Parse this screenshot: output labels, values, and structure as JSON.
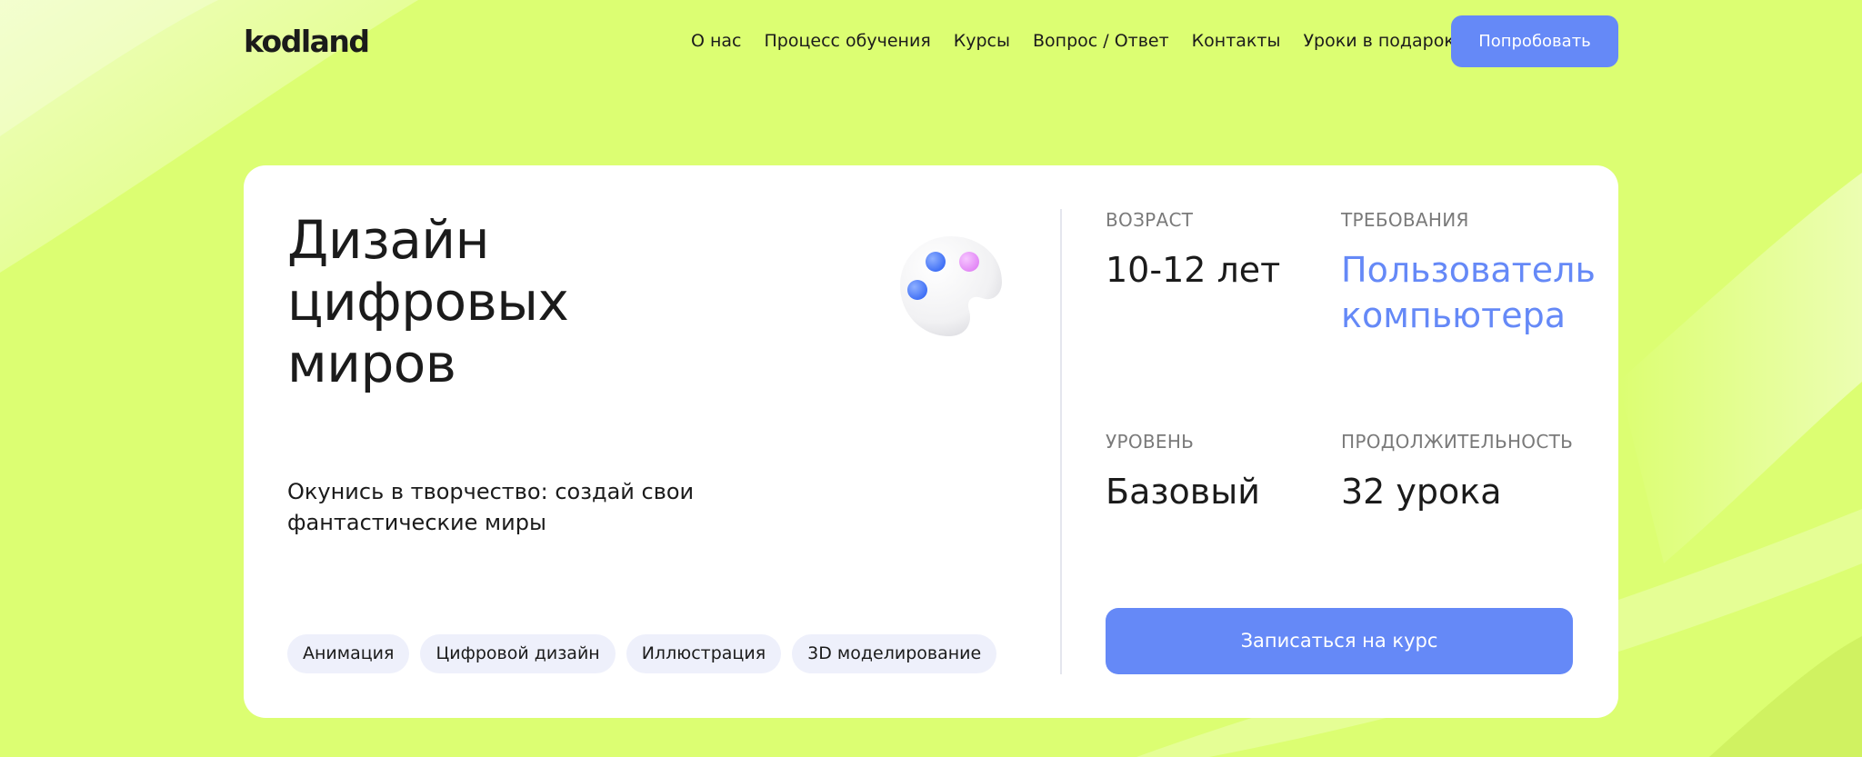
{
  "brand": {
    "logo_text": "kodland",
    "background_color": "#dcfe72",
    "accent_color": "#6589f7"
  },
  "header": {
    "nav": [
      {
        "label": "О нас"
      },
      {
        "label": "Процесс обучения"
      },
      {
        "label": "Курсы"
      },
      {
        "label": "Вопрос / Ответ"
      },
      {
        "label": "Контакты"
      },
      {
        "label": "Уроки в подарок"
      }
    ],
    "cta_label": "Попробовать"
  },
  "course": {
    "title_lines": [
      "Дизайн",
      "цифровых",
      "миров"
    ],
    "icon": "palette-icon",
    "description_lines": [
      "Окунись в творчество: создай свои",
      "фантастические миры"
    ],
    "tags": [
      {
        "label": "Анимация"
      },
      {
        "label": "Цифровой дизайн"
      },
      {
        "label": "Иллюстрация"
      },
      {
        "label": "3D моделирование"
      }
    ],
    "info": {
      "age": {
        "label": "ВОЗРАСТ",
        "value": "10-12 лет"
      },
      "requirements": {
        "label": "ТРЕБОВАНИЯ",
        "value_lines": [
          "Пользователь",
          "компьютера"
        ]
      },
      "level": {
        "label": "УРОВЕНЬ",
        "value": "Базовый"
      },
      "duration": {
        "label": "ПРОДОЛЖИТЕЛЬНОСТЬ",
        "value": "32 урока"
      }
    },
    "enroll_label": "Записаться на курс"
  }
}
